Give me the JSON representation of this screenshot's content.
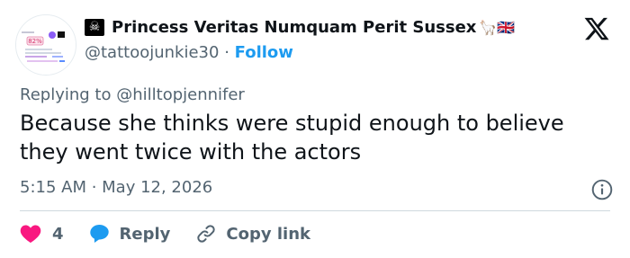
{
  "author": {
    "display_name": "Princess Veritas Numquam Perit Sussex",
    "flag_glyph": "☠",
    "name_emoji": "🦙🇬🇧",
    "handle": "@tattoojunkie30",
    "separator": "·",
    "follow_label": "Follow",
    "avatar_badge": "82%"
  },
  "reply_context": {
    "prefix": "Replying to",
    "mention": "@hilltopjennifer"
  },
  "tweet": {
    "text": "Because she thinks were stupid enough to believe they went twice with the actors",
    "timestamp": "5:15 AM · May 12, 2026"
  },
  "actions": {
    "like_count": "4",
    "reply_label": "Reply",
    "copy_link_label": "Copy link"
  },
  "colors": {
    "like": "#f91880",
    "reply": "#1d9bf0",
    "link": "#1d9bf0",
    "muted": "#536471"
  }
}
